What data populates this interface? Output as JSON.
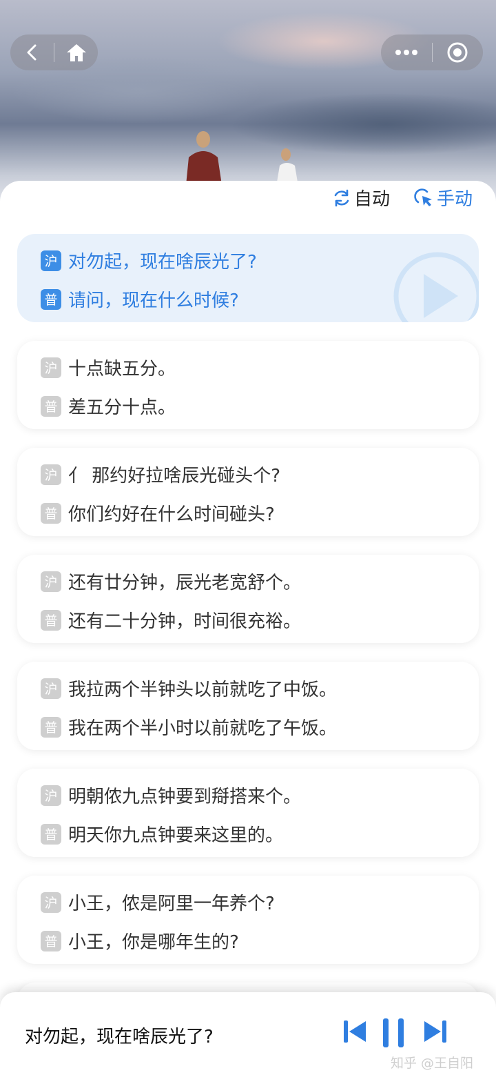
{
  "header": {
    "nav_buttons": [
      "back-icon",
      "home-icon",
      "more-icon",
      "capsule-close-icon"
    ]
  },
  "modes": {
    "auto_label": "自动",
    "manual_label": "手动",
    "accent": "#2f7ee0"
  },
  "tags": {
    "dialect": "沪",
    "mandarin": "普"
  },
  "phrases": [
    {
      "dialect": "对勿起，现在啥辰光了?",
      "mandarin": "请问，现在什么时候?",
      "active": true
    },
    {
      "dialect": "十点缺五分。",
      "mandarin": "差五分十点。"
    },
    {
      "dialect": "亻 那约好拉啥辰光碰头个?",
      "mandarin": "你们约好在什么时间碰头?"
    },
    {
      "dialect": "还有廿分钟，辰光老宽舒个。",
      "mandarin": "还有二十分钟，时间很充裕。"
    },
    {
      "dialect": "我拉两个半钟头以前就吃了中饭。",
      "mandarin": "我在两个半小时以前就吃了午饭。"
    },
    {
      "dialect": "明朝侬九点钟要到搿搭来个。",
      "mandarin": "明天你九点钟要来这里的。"
    },
    {
      "dialect": "小王，侬是阿里一年养个?",
      "mandarin": "小王，你是哪年生的?"
    }
  ],
  "player": {
    "current_text": "对勿起，现在啥辰光了?",
    "controls": [
      "previous-icon",
      "pause-icon",
      "next-icon"
    ]
  },
  "watermark": "知乎 @王自阳"
}
